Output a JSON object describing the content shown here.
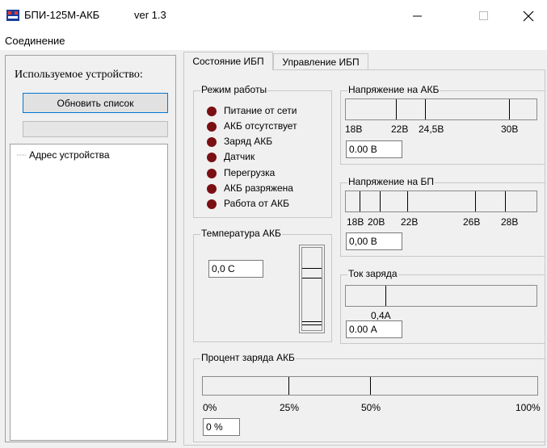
{
  "window": {
    "title": "БПИ-125М-АКБ",
    "version": "ver 1.3",
    "minimize_icon": "minimize-icon",
    "maximize_icon": "maximize-icon",
    "close_icon": "close-icon"
  },
  "menu": {
    "connection": "Соединение"
  },
  "sidebar": {
    "title": "Используемое устройство:",
    "refresh_button": "Обновить список",
    "tree_item": "Адрес устройства"
  },
  "tabs": [
    {
      "label": "Состояние ИБП",
      "active": true
    },
    {
      "label": "Управление ИБП",
      "active": false
    }
  ],
  "mode_group": {
    "title": "Режим работы",
    "led_color": "#7a0f14",
    "indicators": [
      "Питание от сети",
      "АКБ отсутствует",
      "Заряд АКБ",
      "Датчик",
      "Перегрузка",
      "АКБ разряжена",
      "Работа от АКБ"
    ]
  },
  "battery_voltage": {
    "title": "Напряжение на АКБ",
    "scale": [
      "18В",
      "22В",
      "24,5В",
      "30В"
    ],
    "value": "0.00 В"
  },
  "psu_voltage": {
    "title": "Напряжение на БП",
    "scale": [
      "18В",
      "20В",
      "22В",
      "26В",
      "28В"
    ],
    "value": "0,00 В"
  },
  "temperature": {
    "title": "Температура АКБ",
    "value": "0,0 С"
  },
  "charge_current": {
    "title": "Ток заряда",
    "scale": [
      "0,4А"
    ],
    "value": "0.00 А"
  },
  "charge_percent": {
    "title": "Процент заряда АКБ",
    "scale": [
      "0%",
      "25%",
      "50%",
      "100%"
    ],
    "value": "0 %"
  }
}
